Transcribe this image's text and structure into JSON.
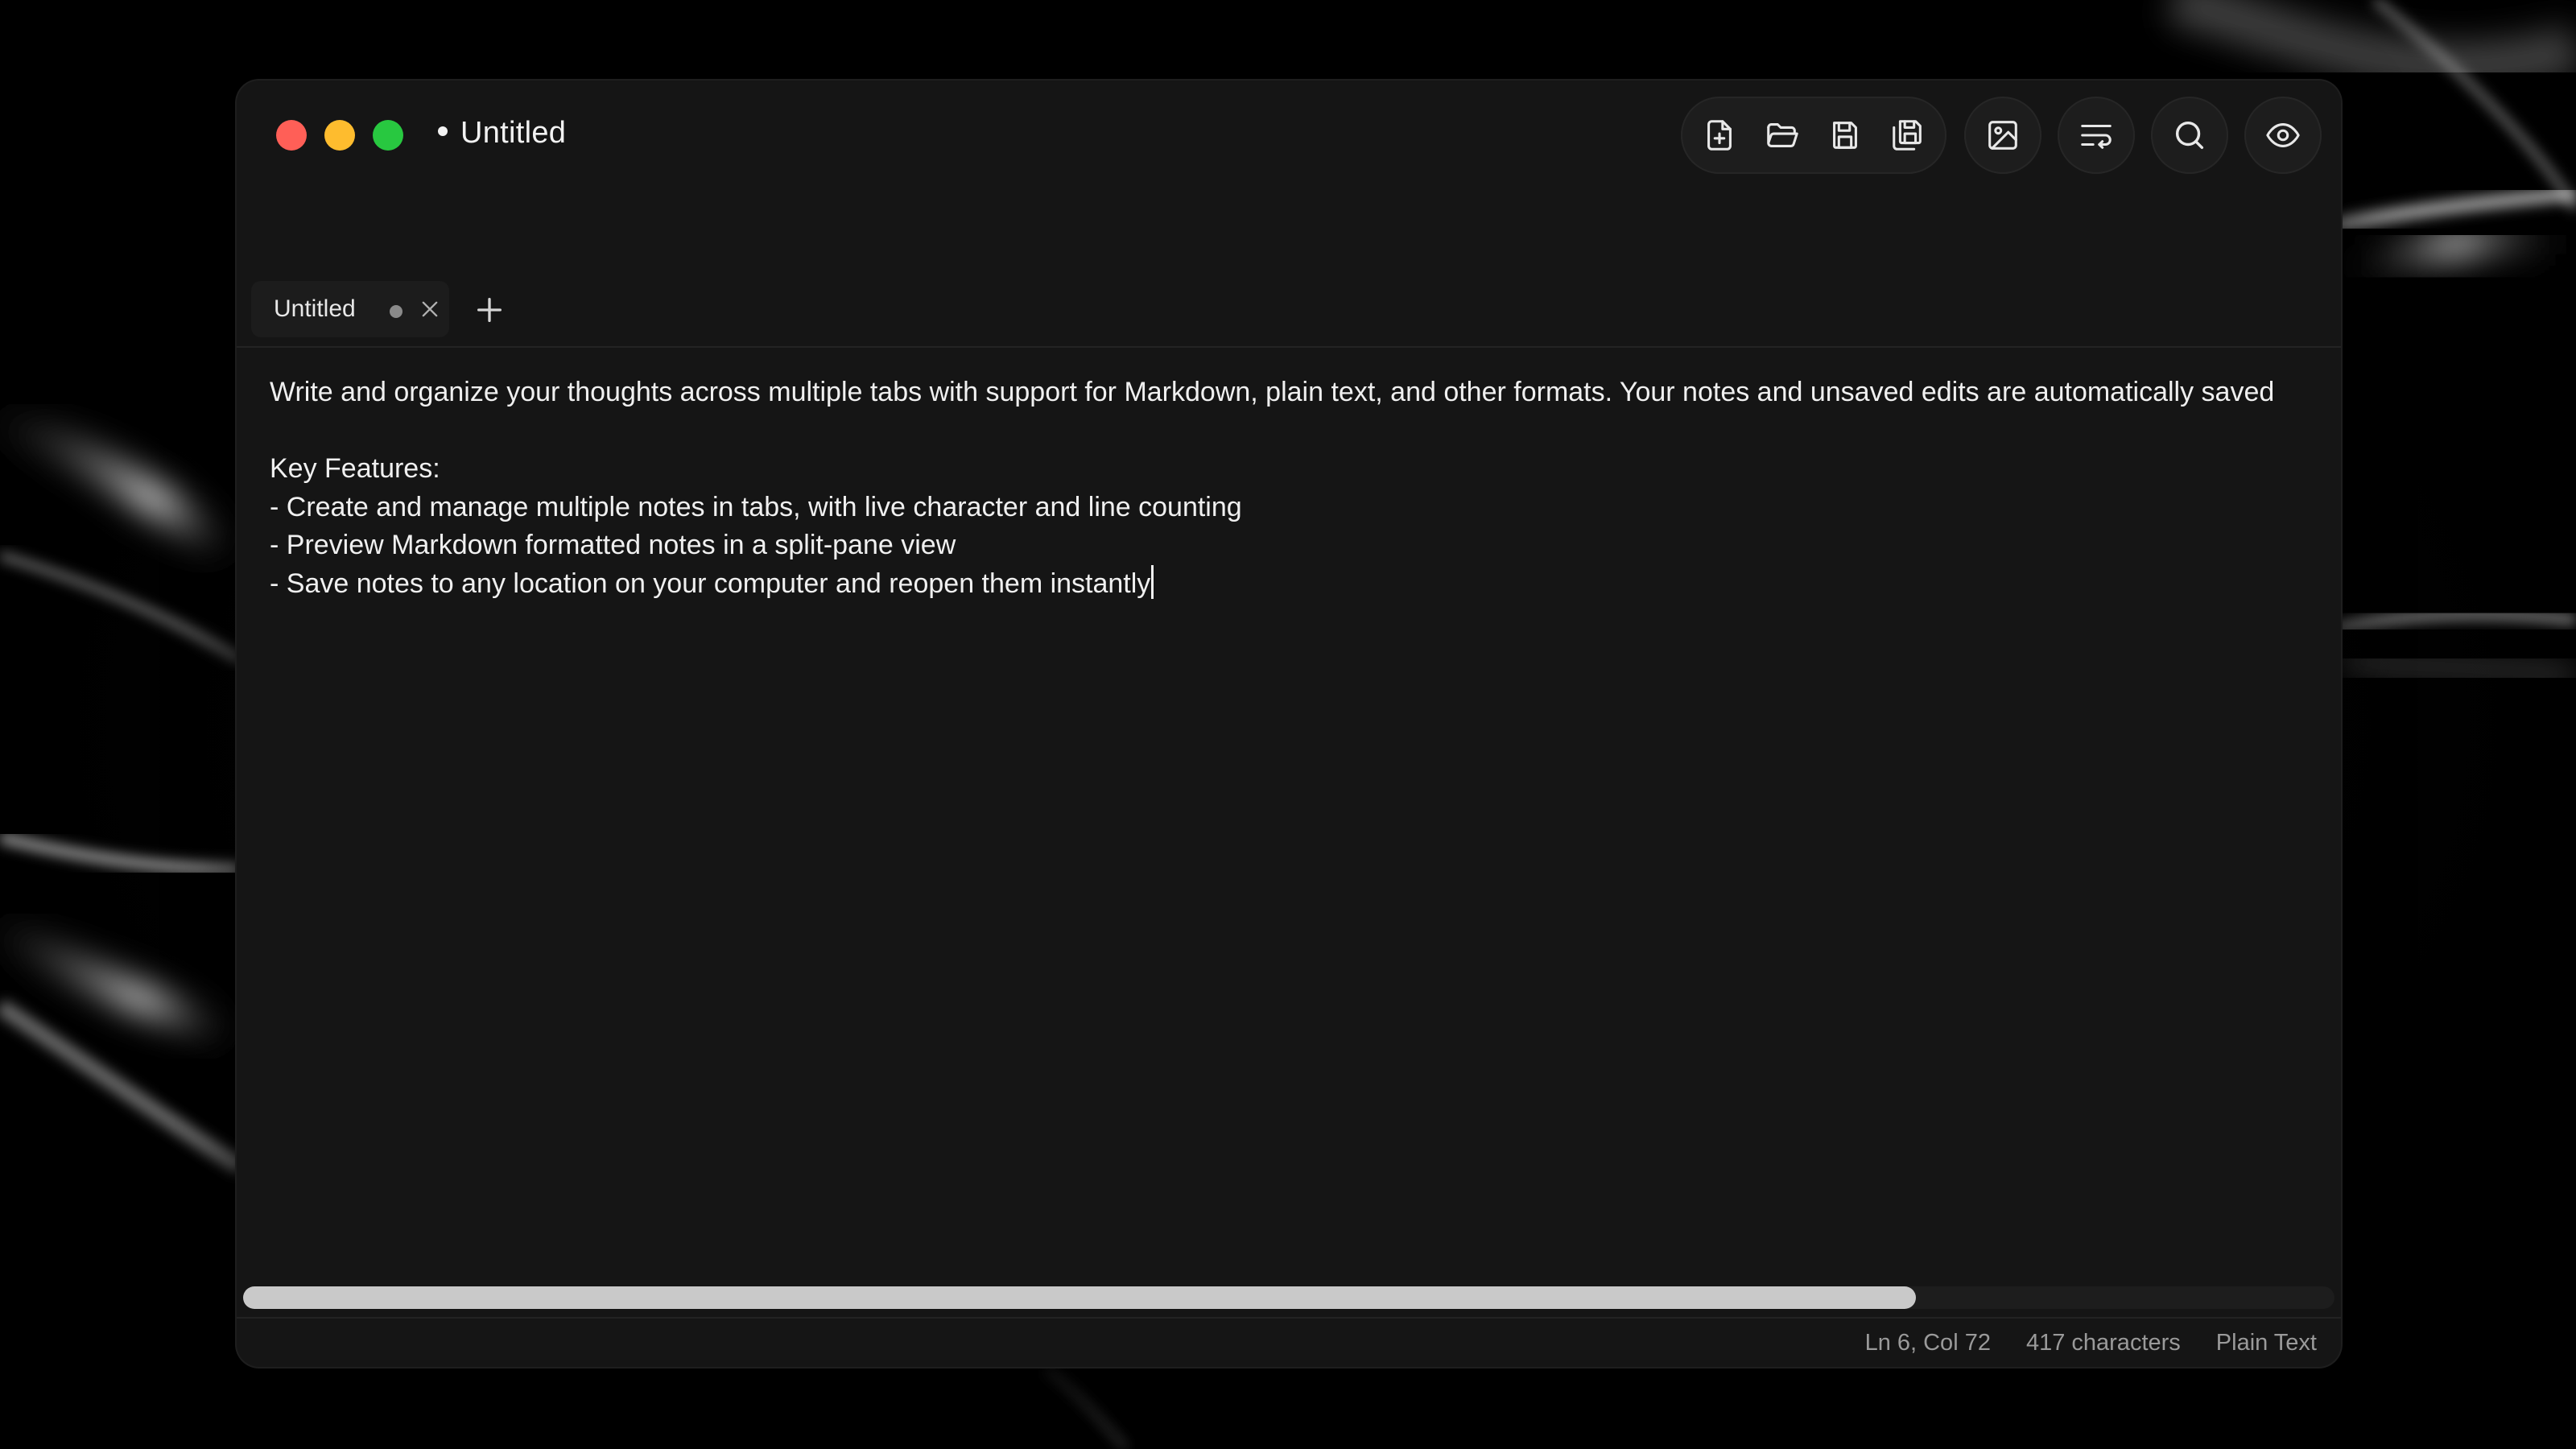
{
  "window": {
    "title": "Untitled",
    "unsaved_indicator": "•"
  },
  "traffic_lights": {
    "close_color": "#ff5f57",
    "minimize_color": "#febc2e",
    "maximize_color": "#28c840"
  },
  "toolbar": {
    "file_group": [
      {
        "icon": "new-file-icon"
      },
      {
        "icon": "open-folder-icon"
      },
      {
        "icon": "save-icon"
      },
      {
        "icon": "save-as-icon"
      }
    ],
    "insert_image": {
      "icon": "image-icon"
    },
    "word_wrap": {
      "icon": "wrap-text-icon"
    },
    "search": {
      "icon": "search-icon"
    },
    "preview": {
      "icon": "eye-icon"
    }
  },
  "tabs": [
    {
      "label": "Untitled",
      "modified": true,
      "active": true
    }
  ],
  "editor": {
    "lines": [
      "Write and organize your thoughts across multiple tabs with support for Markdown, plain text, and other formats. Your notes and unsaved edits are automatically saved",
      "",
      "Key Features:",
      "- Create and manage multiple notes in tabs, with live character and line counting",
      "- Preview Markdown formatted notes in a split-pane view",
      "- Save notes to any location on your computer and reopen them instantly"
    ]
  },
  "scrollbar": {
    "horizontal_visible_fraction": 0.8
  },
  "status": {
    "cursor": "Ln 6, Col 72",
    "characters": "417 characters",
    "language": "Plain Text"
  }
}
